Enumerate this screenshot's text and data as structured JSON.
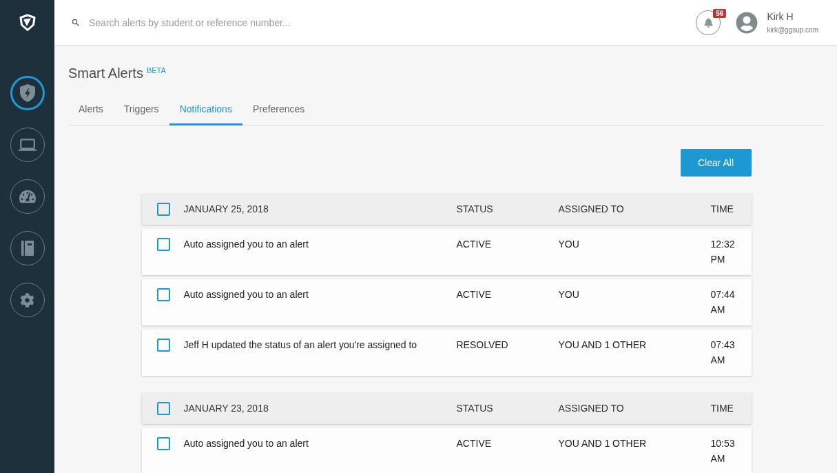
{
  "sidebar": {
    "nav_items": [
      {
        "selected": true
      },
      {
        "selected": false
      },
      {
        "selected": false
      },
      {
        "selected": false
      },
      {
        "selected": false
      }
    ]
  },
  "top_bar": {
    "search": {
      "placeholder": "Search alerts by student or reference number..."
    },
    "notifications": {
      "count": "56"
    },
    "user": {
      "name": "Kirk H",
      "email": "kirk@ggsup.com"
    }
  },
  "page": {
    "title": "Smart Alerts",
    "title_badge": "BETA",
    "tabs": [
      {
        "label": "Alerts",
        "selected": false
      },
      {
        "label": "Triggers",
        "selected": false
      },
      {
        "label": "Notifications",
        "selected": true
      },
      {
        "label": "Preferences",
        "selected": false
      }
    ],
    "clear_button": "Clear All",
    "groups": [
      {
        "date": "JANUARY 25, 2018",
        "checked": false,
        "columns": [
          "STATUS",
          "ASSIGNED TO",
          "TIME"
        ],
        "rows": [
          {
            "message": "Auto assigned you to an alert",
            "status": "ACTIVE",
            "assigned_to": "YOU",
            "time": "12:32 PM",
            "checked": false
          },
          {
            "message": "Auto assigned you to an alert",
            "status": "ACTIVE",
            "assigned_to": "YOU",
            "time": "07:44 AM",
            "checked": false
          },
          {
            "message": "Jeff H updated the status of an alert you're assigned to",
            "status": "RESOLVED",
            "assigned_to": "YOU AND 1 OTHER",
            "time": "07:43 AM",
            "checked": false
          }
        ]
      },
      {
        "date": "JANUARY 23, 2018",
        "checked": false,
        "columns": [
          "STATUS",
          "ASSIGNED TO",
          "TIME"
        ],
        "rows": [
          {
            "message": "Auto assigned you to an alert",
            "status": "ACTIVE",
            "assigned_to": "YOU AND 1 OTHER",
            "time": "10:53 AM",
            "checked": false
          }
        ]
      }
    ]
  }
}
